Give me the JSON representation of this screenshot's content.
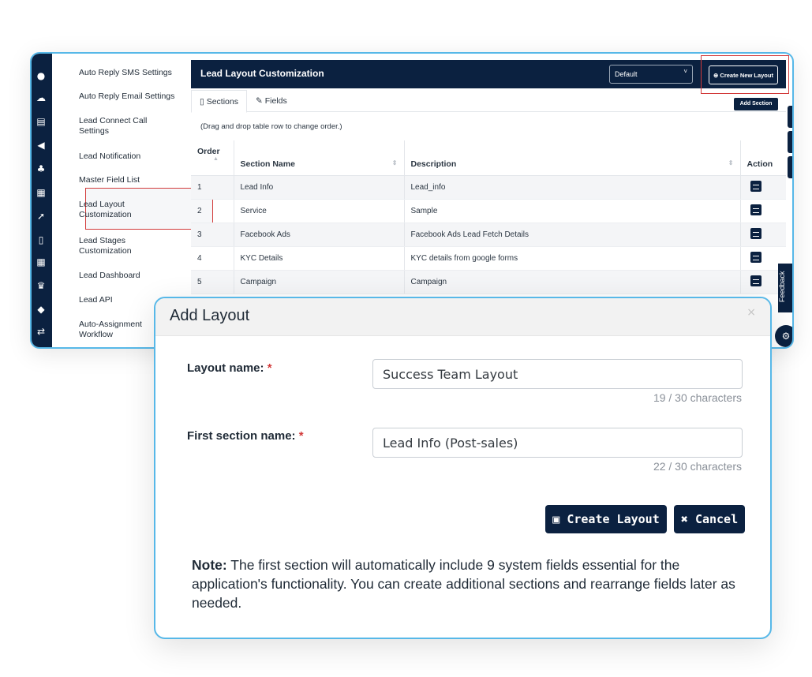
{
  "rail": {
    "icons": [
      "user-icon",
      "cloud-icon",
      "calendar-icon",
      "megaphone-icon",
      "team-icon",
      "grid-icon",
      "rocket-icon",
      "mobile-icon",
      "apps-icon",
      "trophy-icon",
      "ticket-icon",
      "shuffle-icon"
    ]
  },
  "side_menu": {
    "items": [
      {
        "label": "Auto Reply SMS Settings"
      },
      {
        "label": "Auto Reply Email Settings"
      },
      {
        "label": "Lead Connect Call Settings"
      },
      {
        "label": "Lead Notification"
      },
      {
        "label": "Master Field List"
      },
      {
        "label": "Lead Layout Customization"
      },
      {
        "label": "Lead Stages Customization"
      },
      {
        "label": "Lead Dashboard"
      },
      {
        "label": "Lead API"
      },
      {
        "label": "Auto-Assignment Workflow"
      }
    ]
  },
  "header": {
    "title": "Lead Layout Customization",
    "layout_select": "Default",
    "create_new_layout": "Create New Layout"
  },
  "tabs": [
    {
      "label": "Sections"
    },
    {
      "label": "Fields"
    }
  ],
  "add_section_label": "Add Section",
  "drag_hint": "(Drag and drop table row to change order.)",
  "table": {
    "headers": {
      "order": "Order",
      "name": "Section Name",
      "description": "Description",
      "action": "Action"
    },
    "rows": [
      {
        "order": "1",
        "name": "Lead Info",
        "description": "Lead_info"
      },
      {
        "order": "2",
        "name": "Service",
        "description": "Sample"
      },
      {
        "order": "3",
        "name": "Facebook Ads",
        "description": "Facebook Ads Lead Fetch Details"
      },
      {
        "order": "4",
        "name": "KYC Details",
        "description": "KYC details from google forms"
      },
      {
        "order": "5",
        "name": "Campaign",
        "description": "Campaign"
      }
    ]
  },
  "feedback_label": "Feedback",
  "modal": {
    "title": "Add Layout",
    "layout_name_label": "Layout name:",
    "layout_name_value": "Success Team Layout",
    "layout_name_count": "19 / 30 characters",
    "section_name_label": "First section name:",
    "section_name_value": "Lead Info (Post-sales)",
    "section_name_count": "22 / 30 characters",
    "required_mark": "*",
    "create_button": "Create Layout",
    "cancel_button": "Cancel",
    "note_label": "Note:",
    "note_text": "The first section will automatically include 9 system fields essential for the application's functionality. You can create additional sections and rearrange fields later as needed."
  },
  "colors": {
    "navy": "#0b2140",
    "accent_border": "#57b8e8",
    "highlight_red": "#d23a3a"
  }
}
